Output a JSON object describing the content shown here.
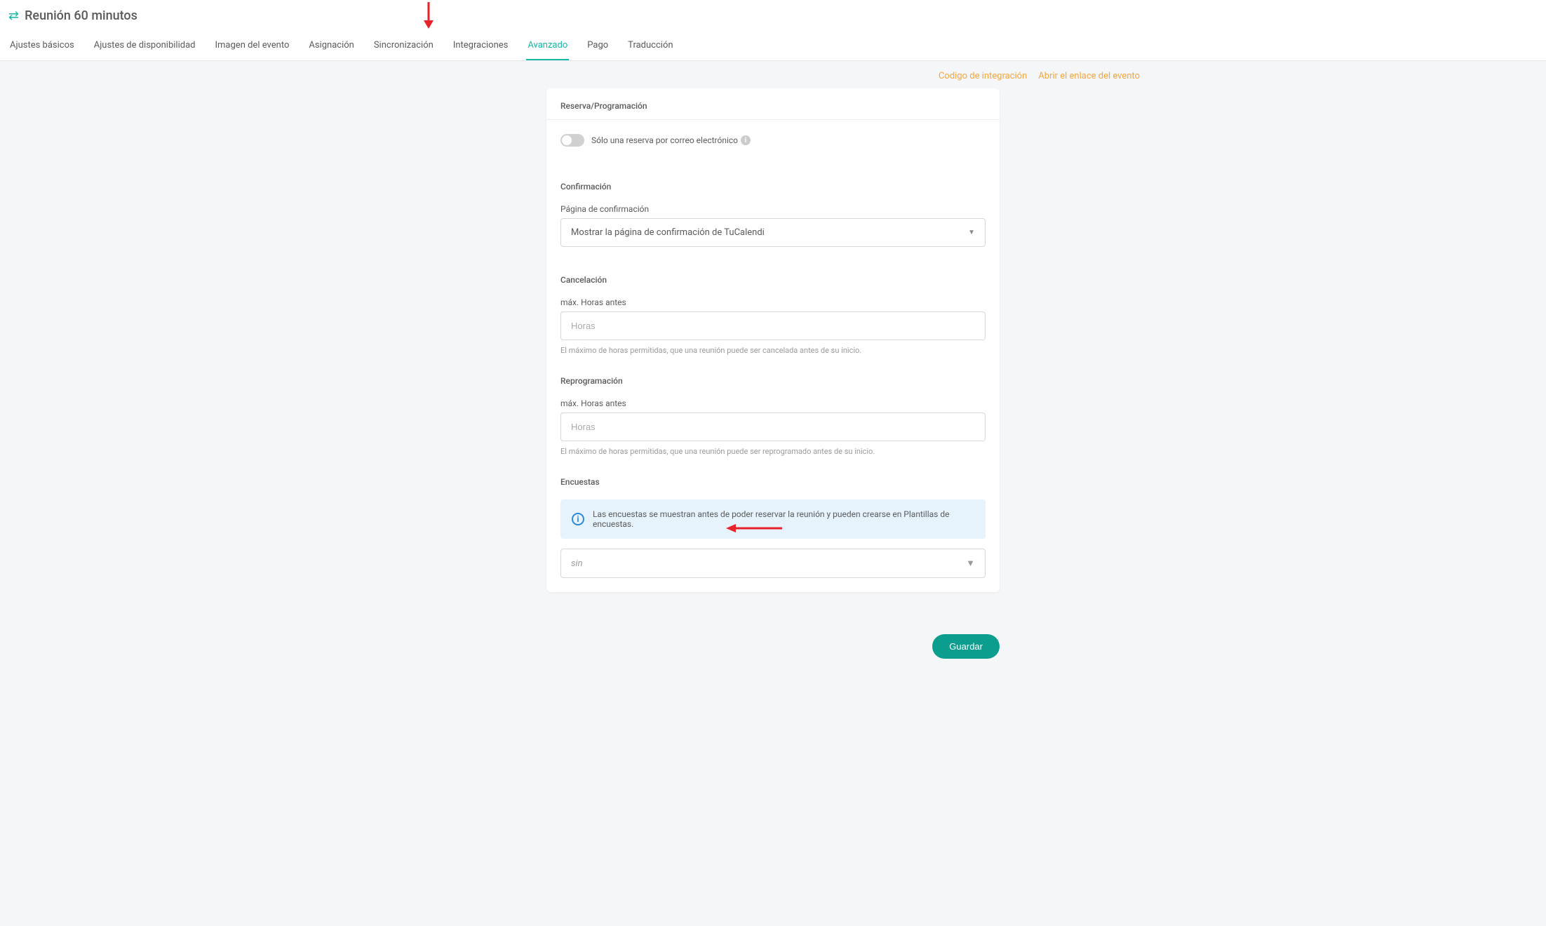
{
  "header": {
    "title": "Reunión 60 minutos",
    "tabs": [
      "Ajustes básicos",
      "Ajustes de disponibilidad",
      "Imagen del evento",
      "Asignación",
      "Sincronización",
      "Integraciones",
      "Avanzado",
      "Pago",
      "Traducción"
    ],
    "active_tab_index": 6
  },
  "top_links": {
    "integration_code": "Codigo de integración",
    "open_event_link": "Abrir el enlace del evento"
  },
  "sections": {
    "booking": {
      "heading": "Reserva/Programación",
      "toggle_one_per_email": "Sólo una reserva por correo electrónico"
    },
    "confirmation": {
      "heading": "Confirmación",
      "page_label": "Página de confirmación",
      "page_value": "Mostrar la página de confirmación de TuCalendi"
    },
    "cancellation": {
      "heading": "Cancelación",
      "max_hours_label": "máx. Horas antes",
      "placeholder": "Horas",
      "help": "El máximo de horas permitidas, que una reunión puede ser cancelada antes de su inicio."
    },
    "reschedule": {
      "heading": "Reprogramación",
      "max_hours_label": "máx. Horas antes",
      "placeholder": "Horas",
      "help": "El máximo de horas permitidas, que una reunión puede ser reprogramado antes de su inicio."
    },
    "surveys": {
      "heading": "Encuestas",
      "info": "Las encuestas se muestran antes de poder reservar la reunión y pueden crearse en Plantillas de encuestas.",
      "select_value": "sin"
    }
  },
  "actions": {
    "save": "Guardar"
  }
}
